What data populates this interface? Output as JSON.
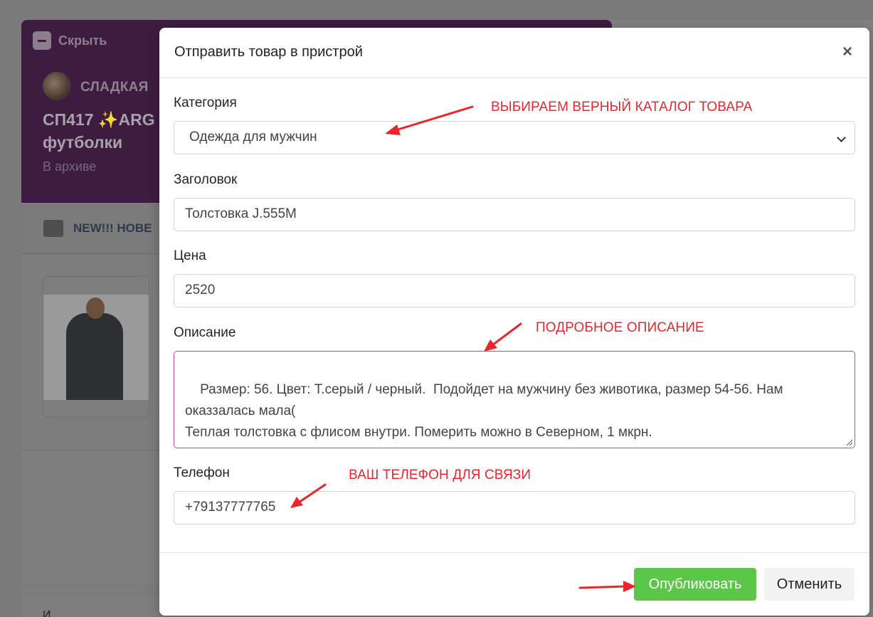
{
  "background": {
    "hide_label": "Скрыть",
    "user_name": "СЛАДКАЯ",
    "title_line1": "СП417 ✨ARG",
    "title_line2": "футболки",
    "archive_label": "В архиве",
    "folder_label": "NEW!!! НОВЕ",
    "bottom_text": "И"
  },
  "modal": {
    "title": "Отправить товар в пристрой",
    "close_symbol": "×",
    "fields": {
      "category": {
        "label": "Категория",
        "value": "Одежда для мужчин"
      },
      "heading": {
        "label": "Заголовок",
        "value": "Толстовка J.555M"
      },
      "price": {
        "label": "Цена",
        "value": "2520"
      },
      "description": {
        "label": "Описание",
        "value": "Размер: 56. Цвет: Т.серый / черный.  Подойдет на мужчину без животика, размер 54-56. Нам оказзалась мала(\nТеплая толстовка с флисом внутри. Померить можно в Северном, 1 мкрн."
      },
      "phone": {
        "label": "Телефон",
        "value": "+79137777765"
      }
    },
    "buttons": {
      "publish": "Опубликовать",
      "cancel": "Отменить"
    }
  },
  "annotations": {
    "category_note": "ВЫБИРАЕМ ВЕРНЫЙ КАТАЛОГ ТОВАРА",
    "description_note": "ПОДРОБНОЕ ОПИСАНИЕ",
    "phone_note": "ВАШ ТЕЛЕФОН ДЛЯ СВЯЗИ"
  },
  "colors": {
    "header_purple": "#3e1c42",
    "publish_green": "#5cc649",
    "annotation_red": "#e8262b",
    "textarea_focus": "#b44ba8"
  }
}
